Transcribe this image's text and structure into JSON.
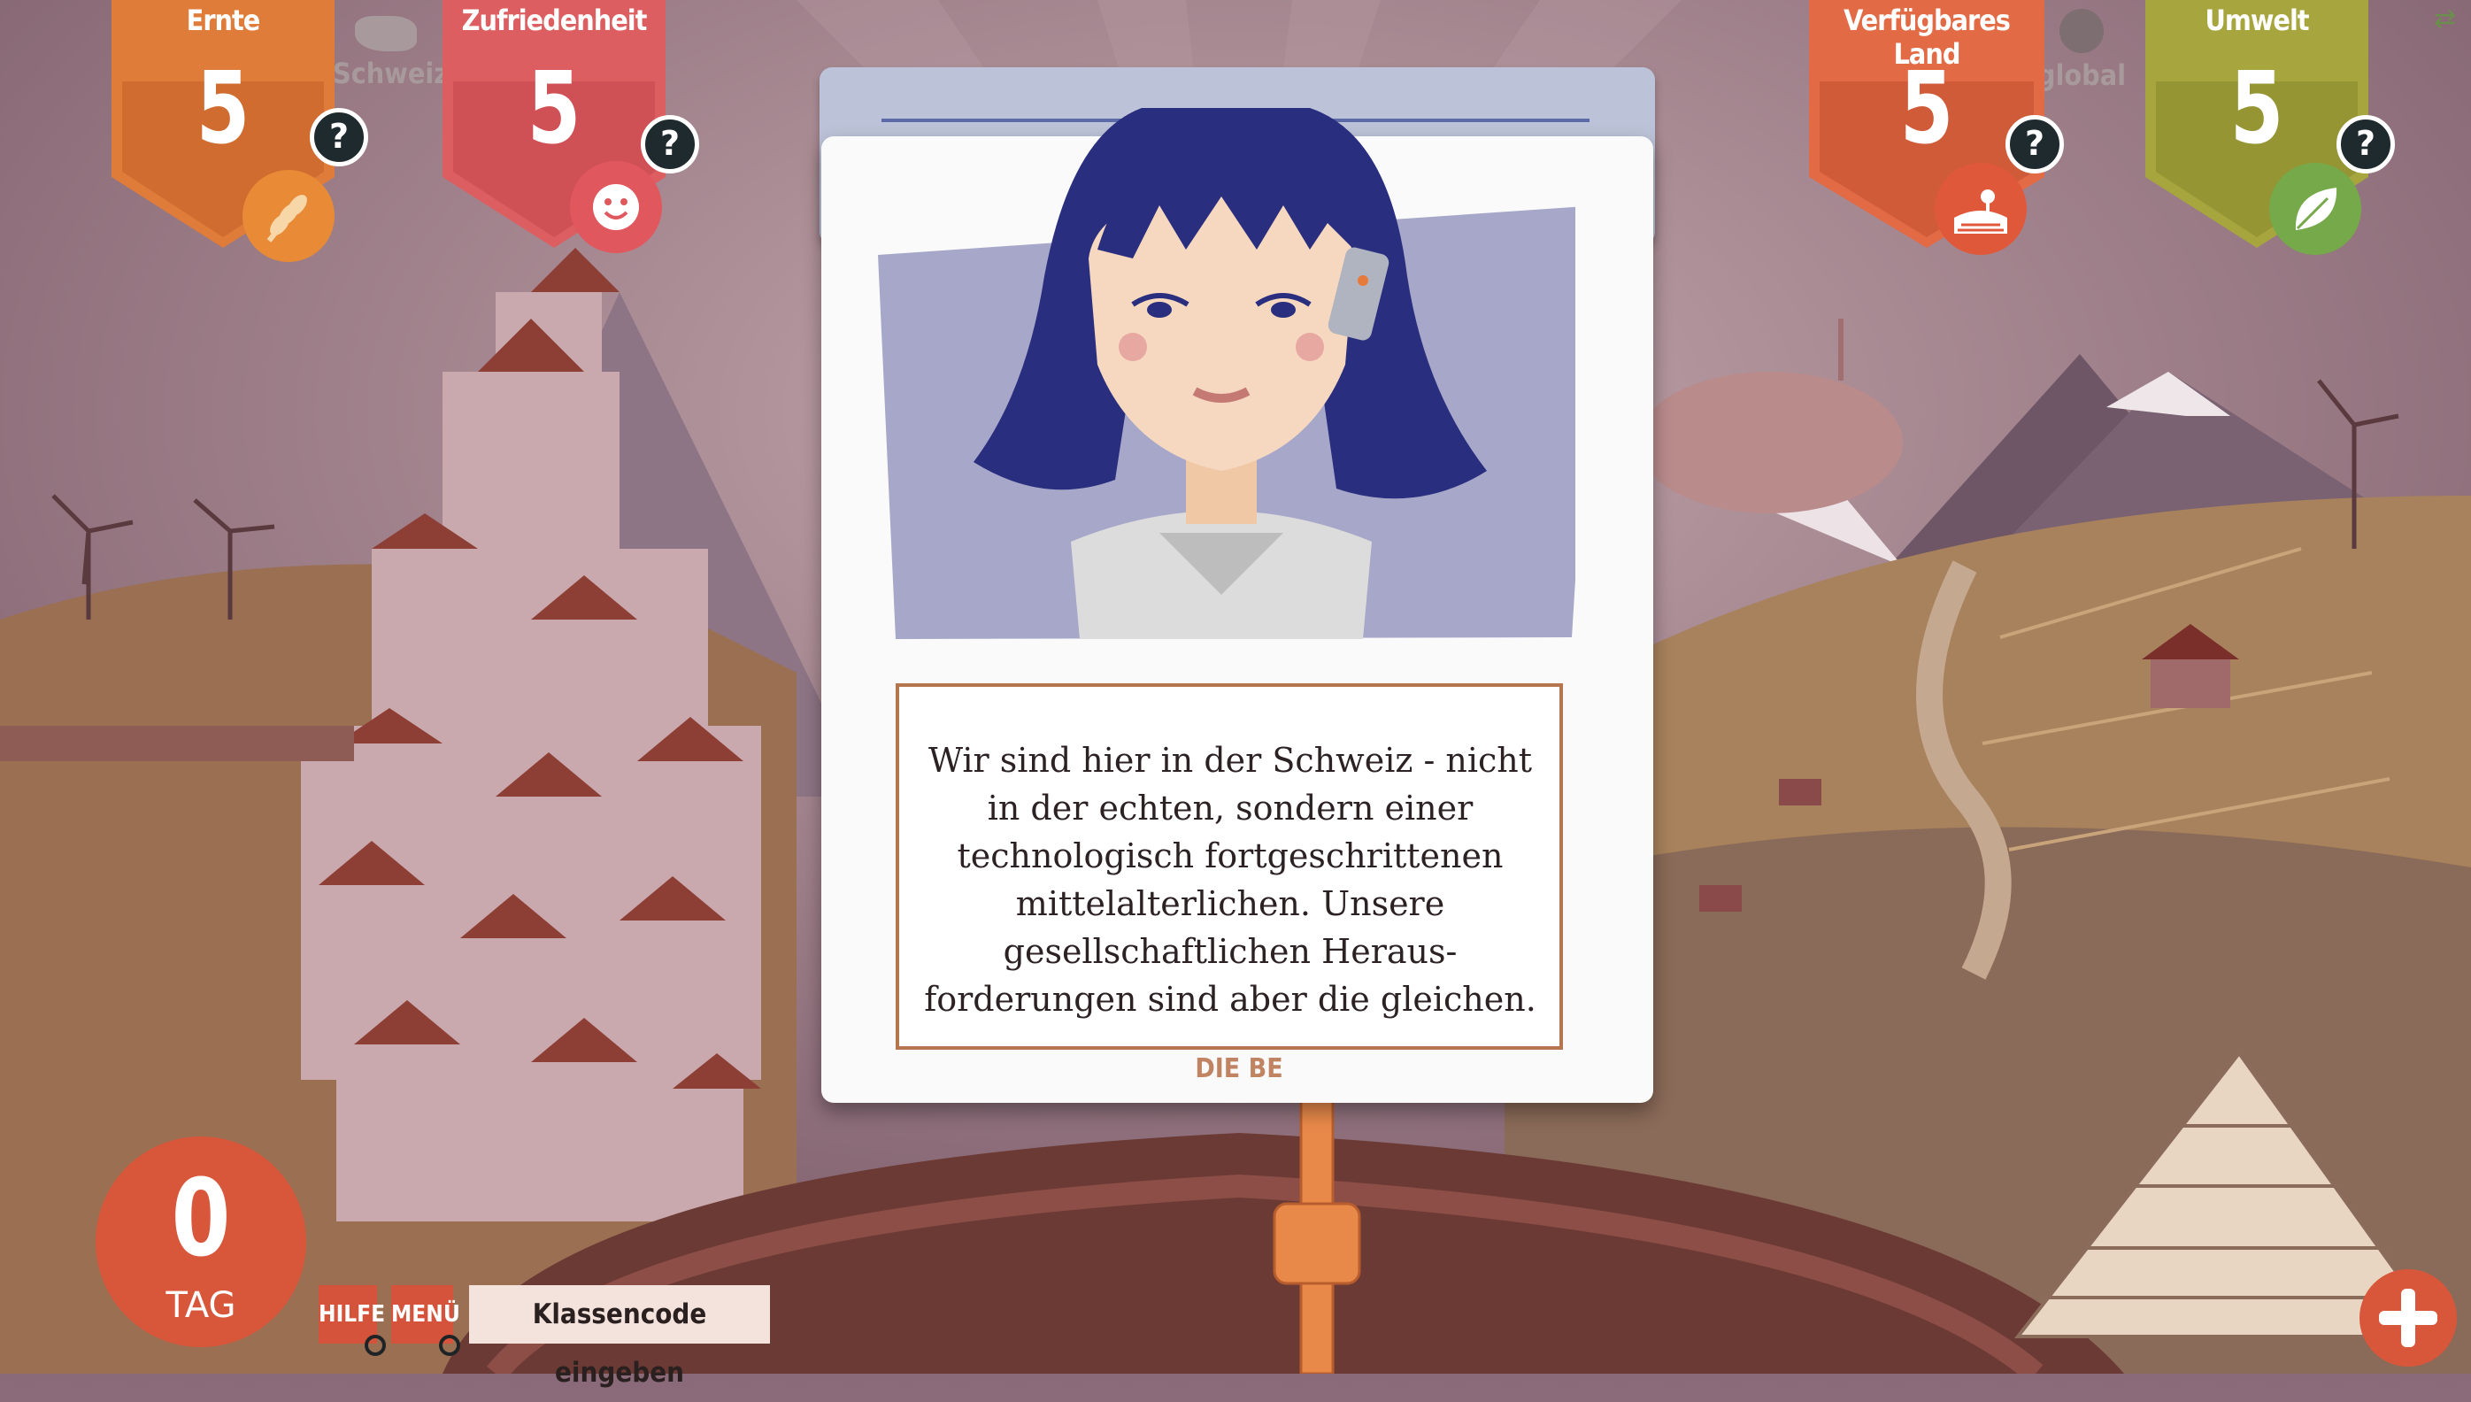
{
  "stats": {
    "harvest": {
      "label": "Ernte",
      "value": "5",
      "color": "#e07c3a",
      "icon": "wheat-icon"
    },
    "satisfaction": {
      "label": "Zufriedenheit",
      "value": "5",
      "color": "#dd5e60",
      "icon": "smiley-icon"
    },
    "land": {
      "label": "Verfügbares Land",
      "value": "5",
      "color": "#e26a45",
      "icon": "farmland-icon"
    },
    "environment": {
      "label": "Umwelt",
      "value": "5",
      "color": "#a6a53e",
      "icon": "leaf-icon"
    }
  },
  "help_label": "?",
  "toggles": {
    "switzerland": "Schweiz",
    "global": "global"
  },
  "card": {
    "text": "Wir sind hier in der Schweiz - nicht in der echten, sondern einer technologisch fortgeschrittenen mittelalterlichen. Unsere gesellschaftlichen Heraus- forderungen sind aber die gleichen.",
    "footer": "DIE BE",
    "character_colors": {
      "hair": "#2a2e7e",
      "background": "#a6a7c9",
      "skin": "#f6d8c0"
    }
  },
  "day": {
    "value": "0",
    "label": "TAG"
  },
  "buttons": {
    "help": "HILFE",
    "menu": "MENÜ",
    "class_code": "Klassencode eingeben"
  },
  "corner_icon": "swap-arrows-icon"
}
